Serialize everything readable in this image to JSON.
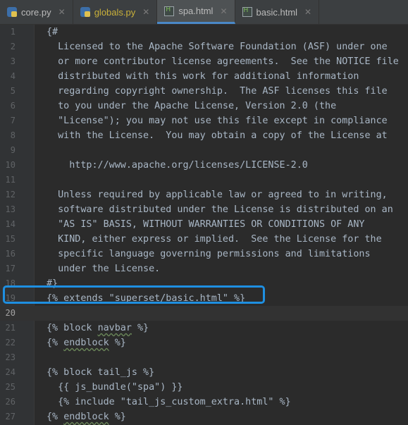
{
  "tabs": [
    {
      "name": "core.py",
      "icon": "python-file-icon",
      "active": false
    },
    {
      "name": "globals.py",
      "icon": "python-file-icon",
      "active": false
    },
    {
      "name": "spa.html",
      "icon": "html-file-icon",
      "active": true
    },
    {
      "name": "basic.html",
      "icon": "html-file-icon",
      "active": false
    }
  ],
  "editor": {
    "current_line": 20,
    "highlighted_line": 19,
    "lines": [
      {
        "n": "1",
        "text": "{#"
      },
      {
        "n": "2",
        "text": "  Licensed to the Apache Software Foundation (ASF) under one"
      },
      {
        "n": "3",
        "text": "  or more contributor license agreements.  See the NOTICE file"
      },
      {
        "n": "4",
        "text": "  distributed with this work for additional information"
      },
      {
        "n": "5",
        "text": "  regarding copyright ownership.  The ASF licenses this file"
      },
      {
        "n": "6",
        "text": "  to you under the Apache License, Version 2.0 (the"
      },
      {
        "n": "7",
        "text": "  \"License\"); you may not use this file except in compliance"
      },
      {
        "n": "8",
        "text": "  with the License.  You may obtain a copy of the License at"
      },
      {
        "n": "9",
        "text": ""
      },
      {
        "n": "10",
        "text": "    http://www.apache.org/licenses/LICENSE-2.0"
      },
      {
        "n": "11",
        "text": ""
      },
      {
        "n": "12",
        "text": "  Unless required by applicable law or agreed to in writing,"
      },
      {
        "n": "13",
        "text": "  software distributed under the License is distributed on an"
      },
      {
        "n": "14",
        "text": "  \"AS IS\" BASIS, WITHOUT WARRANTIES OR CONDITIONS OF ANY"
      },
      {
        "n": "15",
        "text": "  KIND, either express or implied.  See the License for the"
      },
      {
        "n": "16",
        "text": "  specific language governing permissions and limitations"
      },
      {
        "n": "17",
        "text": "  under the License."
      },
      {
        "n": "18",
        "text": "#}"
      },
      {
        "n": "19",
        "text": "{% extends \"superset/basic.html\" %}"
      },
      {
        "n": "20",
        "text": ""
      },
      {
        "n": "21",
        "text": "{% block navbar %}"
      },
      {
        "n": "22",
        "text": "{% endblock %}"
      },
      {
        "n": "23",
        "text": ""
      },
      {
        "n": "24",
        "text": "{% block tail_js %}"
      },
      {
        "n": "25",
        "text": "  {{ js_bundle(\"spa\") }}"
      },
      {
        "n": "26",
        "text": "  {% include \"tail_js_custom_extra.html\" %}"
      },
      {
        "n": "27",
        "text": "{% endblock %}"
      }
    ]
  },
  "colors": {
    "background": "#2b2b2b",
    "gutter": "#313335",
    "text": "#a9b7c6",
    "highlight_border": "#1e8fe1",
    "active_tab_underline": "#4a88c7"
  }
}
